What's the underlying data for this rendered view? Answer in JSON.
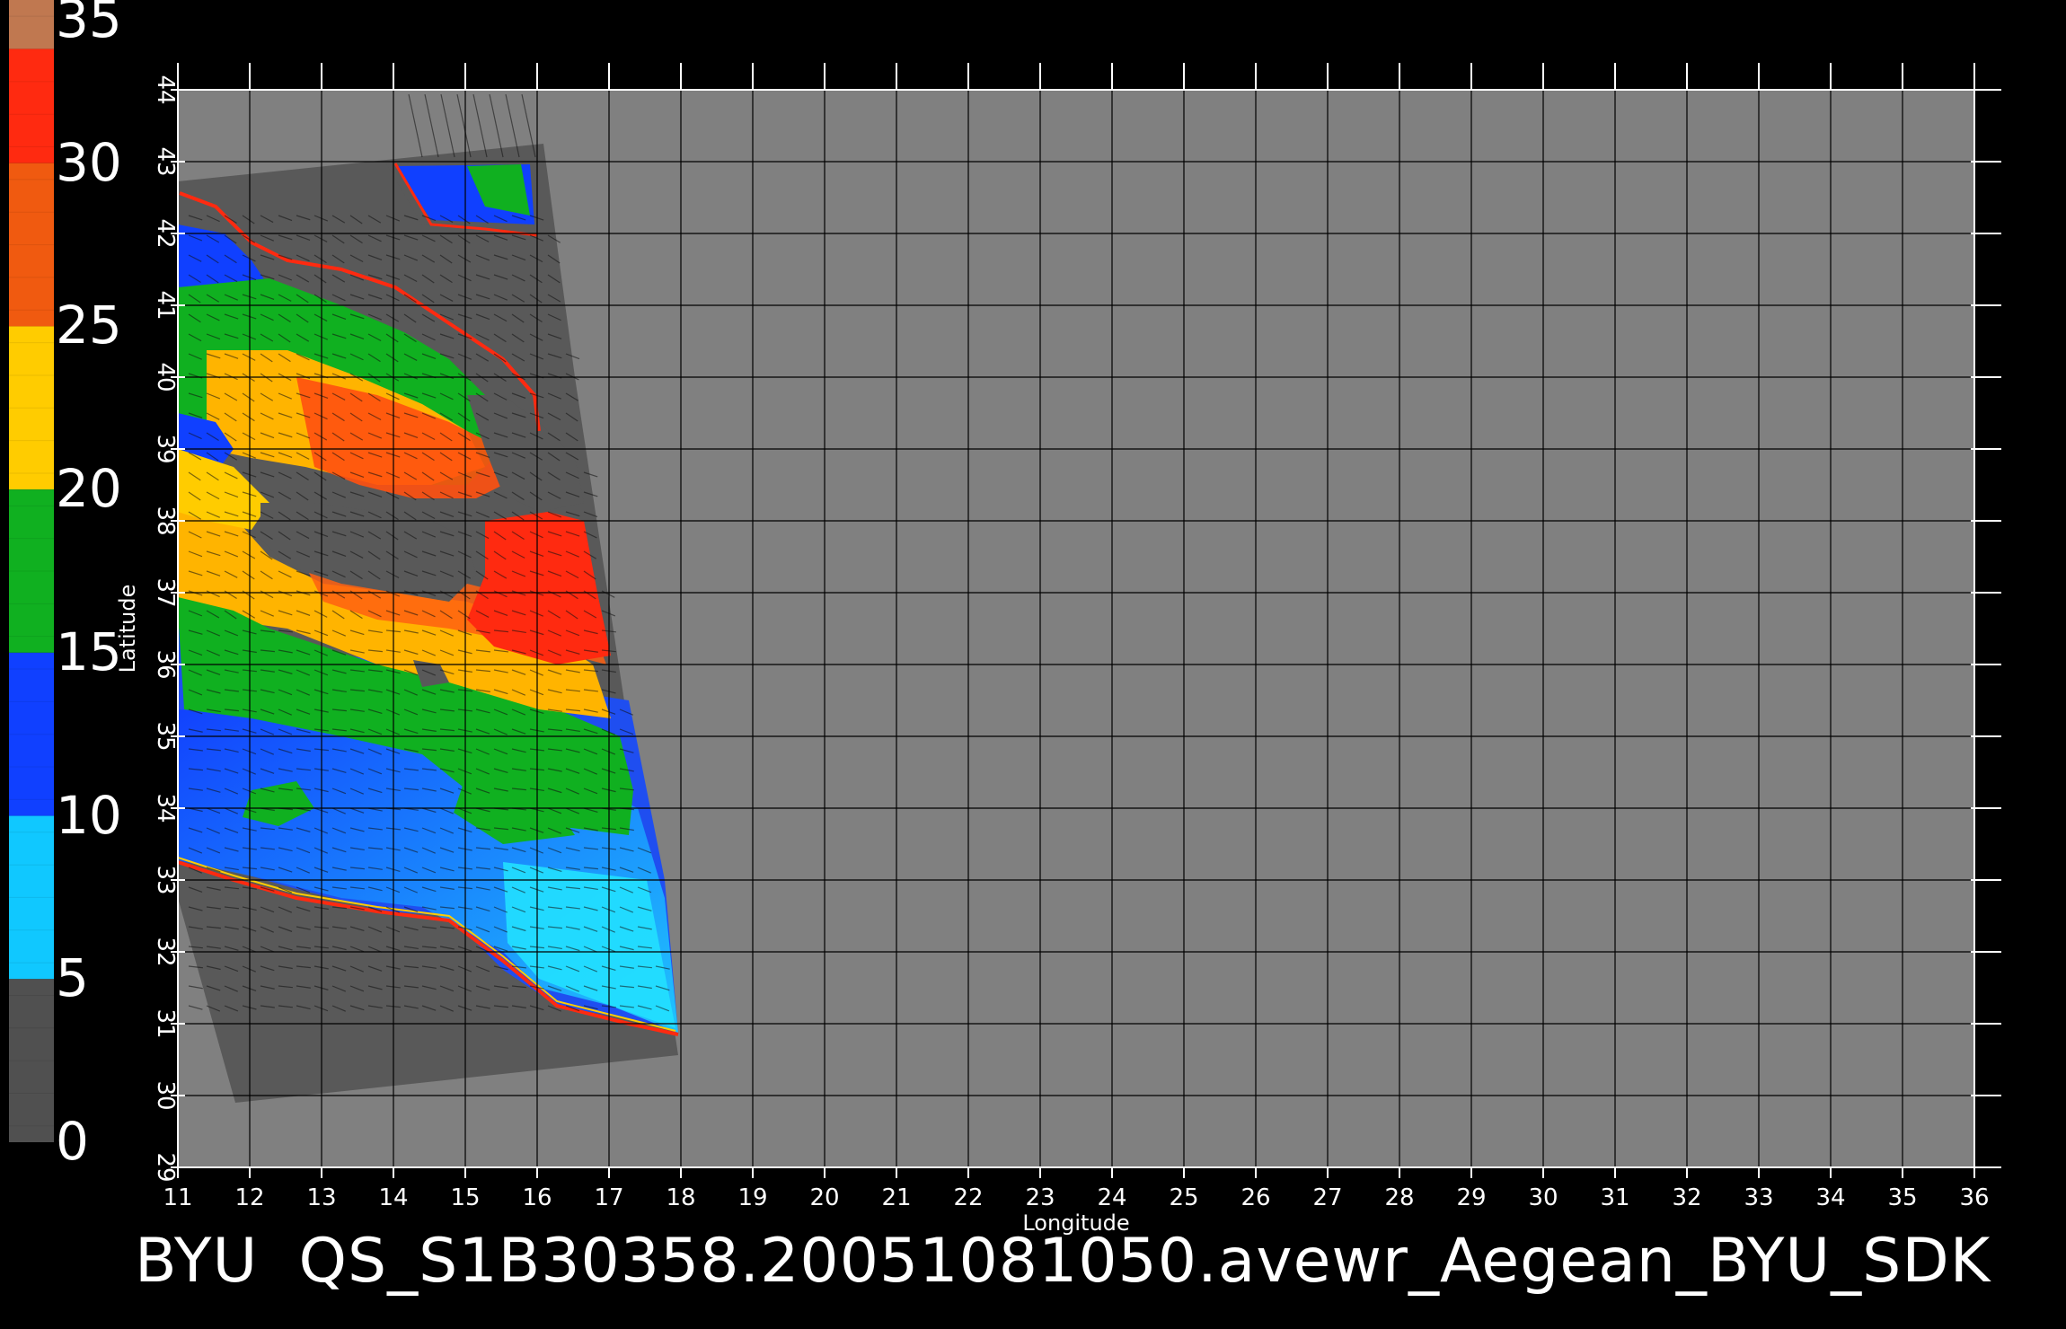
{
  "title": "BYU  QS_S1B30358.20051081050.avewr_Aegean_BYU_SDK",
  "axes": {
    "xlabel": "Longitude",
    "ylabel": "Latitude",
    "lon_ticks": [
      "11",
      "12",
      "13",
      "14",
      "15",
      "16",
      "17",
      "18",
      "19",
      "20",
      "21",
      "22",
      "23",
      "24",
      "25",
      "26",
      "27",
      "28",
      "29",
      "30",
      "31",
      "32",
      "33",
      "34",
      "35",
      "36"
    ],
    "lat_ticks": [
      "29",
      "30",
      "31",
      "32",
      "33",
      "34",
      "35",
      "36",
      "37",
      "38",
      "39",
      "40",
      "41",
      "42",
      "43",
      "44"
    ]
  },
  "colorbar": {
    "labels": [
      "35",
      "30",
      "25",
      "20",
      "15",
      "10",
      "5",
      "0"
    ],
    "segments": [
      {
        "from": 30,
        "to": 35,
        "color": "#ff2a10"
      },
      {
        "from": 25,
        "to": 30,
        "color": "#f05a10"
      },
      {
        "from": 20,
        "to": 25,
        "color": "#ffcc00"
      },
      {
        "from": 15,
        "to": 20,
        "color": "#10b020"
      },
      {
        "from": 10,
        "to": 15,
        "color": "#1040ff"
      },
      {
        "from": 5,
        "to": 10,
        "color": "#10c8ff"
      },
      {
        "from": 0,
        "to": 5,
        "color": "#505050"
      }
    ],
    "top_cap": "#c07850"
  },
  "colors": {
    "background": "#000000",
    "plot_fill": "#808080",
    "swath_land": "#595959",
    "grid": "#000000"
  }
}
